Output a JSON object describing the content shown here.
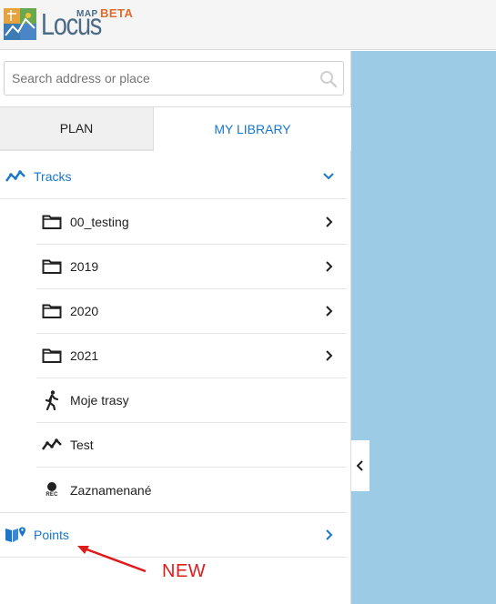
{
  "header": {
    "logo_word": "Locus",
    "logo_map": "MAP",
    "logo_beta": "BETA"
  },
  "search": {
    "placeholder": "Search address or place",
    "value": ""
  },
  "tabs": [
    {
      "label": "PLAN",
      "active": false
    },
    {
      "label": "MY LIBRARY",
      "active": true
    }
  ],
  "library": {
    "tracks": {
      "label": "Tracks",
      "icon": "track-line-icon",
      "expanded": true,
      "items": [
        {
          "label": "00_testing",
          "icon": "folder-icon",
          "has_children": true
        },
        {
          "label": "2019",
          "icon": "folder-icon",
          "has_children": true
        },
        {
          "label": "2020",
          "icon": "folder-icon",
          "has_children": true
        },
        {
          "label": "2021",
          "icon": "folder-icon",
          "has_children": true
        },
        {
          "label": "Moje trasy",
          "icon": "walking-person-icon",
          "has_children": false
        },
        {
          "label": "Test",
          "icon": "track-line-icon",
          "has_children": false
        },
        {
          "label": "Zaznamenané",
          "icon": "record-icon",
          "has_children": false
        }
      ]
    },
    "points": {
      "label": "Points",
      "icon": "map-points-icon",
      "expanded": false
    }
  },
  "rec_badge": "REC",
  "annotation": {
    "text": "NEW",
    "color": "#e01b1b"
  },
  "colors": {
    "accent": "#1976c9",
    "map_water": "#9ccbe6",
    "beta": "#e06b2a",
    "logo": "#4a6a86"
  }
}
